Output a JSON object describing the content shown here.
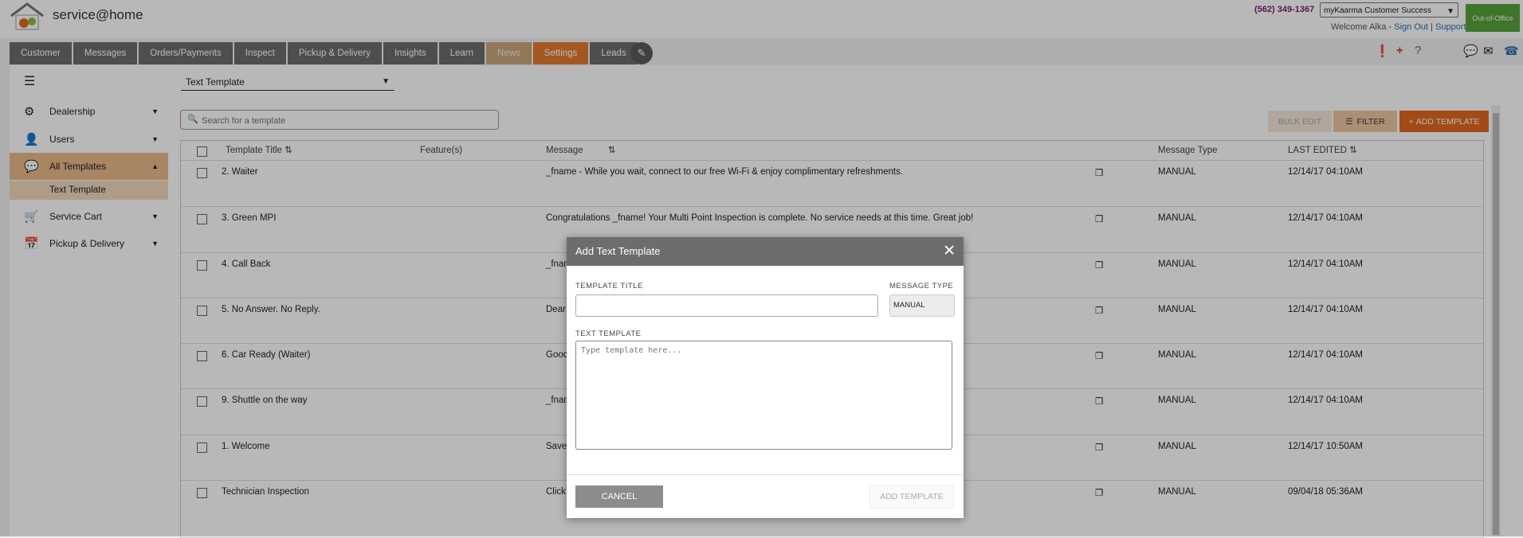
{
  "header": {
    "app_name": "service@home",
    "phone": "(562) 349-1367",
    "account": "myKaarma Customer Success",
    "out_of_office": "Out-of-Office",
    "welcome": "Welcome Alka -",
    "sign_out": "Sign Out",
    "separator": "|",
    "support": "Support"
  },
  "nav": {
    "tabs": [
      "Customer",
      "Messages",
      "Orders/Payments",
      "Inspect",
      "Pickup & Delivery",
      "Insights",
      "Learn",
      "News",
      "Settings",
      "Leads"
    ]
  },
  "sidebar": {
    "items": [
      {
        "label": "Dealership",
        "icon": "gear-icon"
      },
      {
        "label": "Users",
        "icon": "user-icon"
      },
      {
        "label": "All Templates",
        "icon": "chat-icon"
      },
      {
        "label": "Service Cart",
        "icon": "cart-icon"
      },
      {
        "label": "Pickup & Delivery",
        "icon": "calendar-icon"
      }
    ],
    "sub_item": "Text Template"
  },
  "main": {
    "template_select": "Text Template",
    "search_placeholder": "Search for a template",
    "bulk_edit": "BULK EDIT",
    "filter": "FILTER",
    "add_template": "ADD TEMPLATE",
    "columns": [
      "Template Title",
      "Feature(s)",
      "Message",
      "Message Type",
      "LAST EDITED"
    ],
    "rows": [
      {
        "title": "2. Waiter",
        "message": "_fname - While you wait, connect to our free Wi-Fi & enjoy complimentary refreshments.",
        "type": "MANUAL",
        "edited": "12/14/17 04:10AM"
      },
      {
        "title": "3. Green MPI",
        "message": "Congratulations _fname! Your Multi Point Inspection is complete. No service needs at this time. Great job!",
        "type": "MANUAL",
        "edited": "12/14/17 04:10AM"
      },
      {
        "title": "4. Call Back",
        "message": "_fnam",
        "type": "MANUAL",
        "edited": "12/14/17 04:10AM"
      },
      {
        "title": "5. No Answer. No Reply.",
        "message": "Dear",
        "type": "MANUAL",
        "edited": "12/14/17 04:10AM"
      },
      {
        "title": "6. Car Ready (Waiter)",
        "message": "Good",
        "type": "MANUAL",
        "edited": "12/14/17 04:10AM"
      },
      {
        "title": "9. Shuttle on the way",
        "message": "_fnam",
        "type": "MANUAL",
        "edited": "12/14/17 04:10AM"
      },
      {
        "title": "1. Welcome",
        "message": "Save",
        "type": "MANUAL",
        "edited": "12/14/17 10:50AM"
      },
      {
        "title": "Technician Inspection",
        "message": "Click",
        "type": "MANUAL",
        "edited": "09/04/18 05:36AM"
      }
    ]
  },
  "dialog": {
    "title": "Add Text Template",
    "title_label": "TEMPLATE TITLE",
    "type_label": "MESSAGE TYPE",
    "type_value": "MANUAL",
    "text_label": "TEXT TEMPLATE",
    "text_placeholder": "Type template here...",
    "cancel": "CANCEL",
    "add": "ADD TEMPLATE"
  },
  "colors": {
    "accent": "#e2691f",
    "nav": "#6c6c6c",
    "active_side": "#e9b98a"
  }
}
